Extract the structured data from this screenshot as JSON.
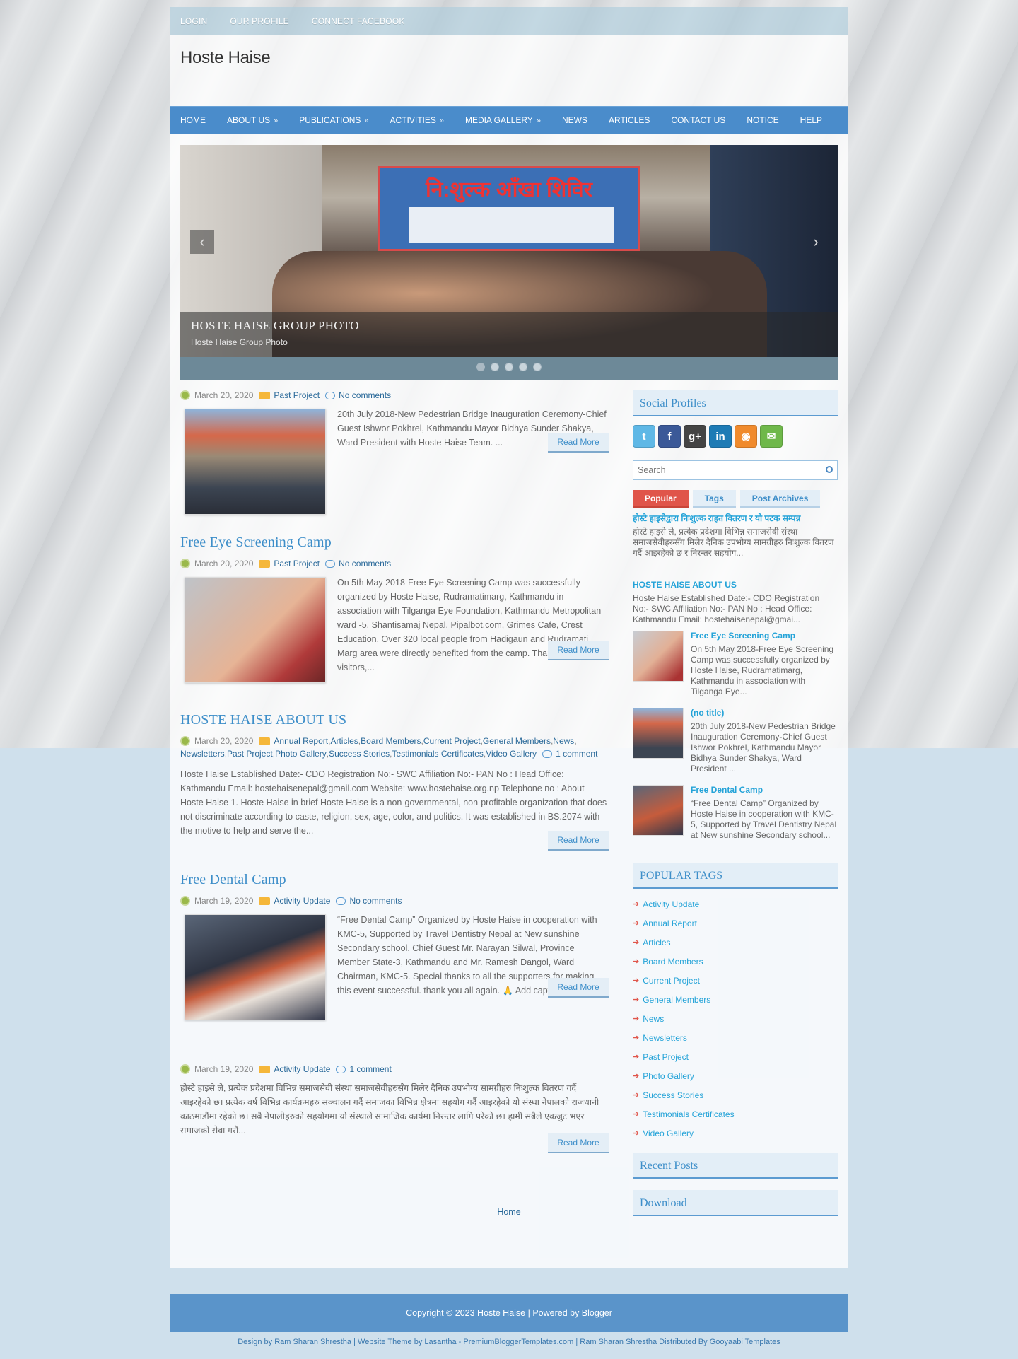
{
  "topbar": {
    "items": [
      "LOGIN",
      "OUR PROFILE",
      "CONNECT FACEBOOK"
    ]
  },
  "site": {
    "title": "Hoste Haise"
  },
  "nav": {
    "items": [
      {
        "label": "HOME",
        "sub": false
      },
      {
        "label": "ABOUT US",
        "sub": true
      },
      {
        "label": "PUBLICATIONS",
        "sub": true
      },
      {
        "label": "ACTIVITIES",
        "sub": true
      },
      {
        "label": "MEDIA GALLERY",
        "sub": true
      },
      {
        "label": "NEWS",
        "sub": false
      },
      {
        "label": "ARTICLES",
        "sub": false
      },
      {
        "label": "CONTACT US",
        "sub": false
      },
      {
        "label": "NOTICE",
        "sub": false
      },
      {
        "label": "HELP",
        "sub": false
      }
    ],
    "arrow": "»"
  },
  "slider": {
    "caption_title": "HOSTE HAISE GROUP PHOTO",
    "caption_sub": "Hoste Haise Group Photo",
    "banner_text": "नि:शुल्क आँखा शिविर",
    "prev": "‹",
    "next": "›",
    "dots": 5,
    "active_dot": 0
  },
  "posts": [
    {
      "title": "",
      "date": "March 20, 2020",
      "labels": [
        "Past Project"
      ],
      "comments": "No comments",
      "snippet": "20th July 2018-New Pedestrian Bridge Inauguration Ceremony-Chief Guest Ishwor Pokhrel, Kathmandu Mayor Bidhya Sunder Shakya, Ward President with Hoste Haise Team. ...",
      "read_more": "Read More"
    },
    {
      "title": "Free Eye Screening Camp",
      "date": "March 20, 2020",
      "labels": [
        "Past Project"
      ],
      "comments": "No comments",
      "snippet": "On 5th May 2018-Free Eye Screening Camp was successfully organized by Hoste Haise, Rudramatimarg, Kathmandu in association with Tilganga Eye Foundation, Kathmandu Metropolitan ward -5, Shantisamaj Nepal, Pipalbot.com, Grimes Cafe, Crest Education. Over 320 local people from Hadigaun and Rudramati Marg area were directly benefited from the camp. Thank you all the visitors,...",
      "read_more": "Read More"
    },
    {
      "title": "HOSTE HAISE ABOUT US",
      "date": "March 20, 2020",
      "labels": [
        "Annual Report",
        "Articles",
        "Board Members",
        "Current Project",
        "General Members",
        "News",
        "Newsletters",
        "Past Project",
        "Photo Gallery",
        "Success Stories",
        "Testimonials Certificates",
        "Video Gallery"
      ],
      "comments": "1 comment",
      "snippet": "Hoste Haise Established Date:- CDO Registration No:- SWC Affiliation No:- PAN No : Head Office: Kathmandu Email: hostehaisenepal@gmail.com Website: www.hostehaise.org.np Telephone no : About Hoste Haise 1. Hoste Haise in brief Hoste Haise is a non-governmental, non-profitable organization that does not discriminate according to caste, religion, sex, age, color, and politics. It was established in BS.2074 with the motive to help and serve the...",
      "read_more": "Read More"
    },
    {
      "title": "Free Dental Camp",
      "date": "March 19, 2020",
      "labels": [
        "Activity Update"
      ],
      "comments": "No comments",
      "snippet": "“Free Dental Camp” Organized by Hoste Haise in cooperation with KMC-5, Supported by Travel Dentistry Nepal at New sunshine Secondary school. Chief Guest Mr. Narayan Silwal, Province Member State-3, Kathmandu and Mr. Ramesh Dangol, Ward Chairman, KMC-5. Special thanks to all the supporters for making this event successful. thank you all again. 🙏 Add caption ...",
      "read_more": "Read More"
    },
    {
      "title": "",
      "date": "March 19, 2020",
      "labels": [
        "Activity Update"
      ],
      "comments": "1 comment",
      "snippet": "होस्टे हाइसे ले, प्रत्येक प्रदेशमा विभिन्न समाजसेवी संस्था समाजसेवीहरुसँग मिलेर दैनिक उपभोग्य सामग्रीहरु निःशुल्क वितरण गर्दै आइरहेको छ। प्रत्येक वर्ष विभिन्न कार्यक्रमहरु सञ्चालन गर्दै समाजका विभिन्न क्षेत्रमा सहयोग गर्दै आइरहेको यो संस्था नेपालको राजधानी काठमाडौंमा रहेको छ। सबै नेपालीहरुको सहयोगमा यो संस्थाले सामाजिक कार्यमा निरन्तर लागि परेको छ। हामी सबैले एकजुट भएर समाजको सेवा गरौं...",
      "read_more": "Read More"
    }
  ],
  "home_link": "Home",
  "sidebar": {
    "social_title": "Social Profiles",
    "social_icons": [
      {
        "name": "twitter",
        "glyph": "t",
        "color": "#5fb8e6"
      },
      {
        "name": "facebook",
        "glyph": "f",
        "color": "#3b5998"
      },
      {
        "name": "google-plus",
        "glyph": "g+",
        "color": "#444"
      },
      {
        "name": "linkedin",
        "glyph": "in",
        "color": "#1e7bb5"
      },
      {
        "name": "rss",
        "glyph": "◉",
        "color": "#f08a2c"
      },
      {
        "name": "email",
        "glyph": "✉",
        "color": "#6fb84a"
      }
    ],
    "search_placeholder": "Search",
    "tabs": [
      "Popular",
      "Tags",
      "Post Archives"
    ],
    "popular": [
      {
        "title": "होस्टे हाइसेद्वारा निःशुल्क राहत वितरण र यो पटक सम्पन्न",
        "text": "होस्टे हाइसे ले, प्रत्येक प्रदेशमा विभिन्न समाजसेवी संस्था समाजसेवीहरुसँग मिलेर दैनिक उपभोग्य सामग्रीहरु निःशुल्क वितरण गर्दै आइरहेको छ र निरन्तर सहयोग..."
      },
      {
        "title": "HOSTE HAISE ABOUT US",
        "text": "Hoste Haise Established Date:- CDO Registration No:- SWC Affiliation No:- PAN No : Head Office: Kathmandu Email: hostehaisenepal@gmai..."
      },
      {
        "title": "Free Eye Screening Camp",
        "text": "On 5th May 2018-Free Eye Screening Camp was successfully organized by Hoste Haise, Rudramatimarg, Kathmandu in association with Tilganga Eye..."
      },
      {
        "title": "(no title)",
        "text": "20th July 2018-New Pedestrian Bridge Inauguration Ceremony-Chief Guest Ishwor Pokhrel, Kathmandu Mayor Bidhya Sunder Shakya, Ward President ..."
      },
      {
        "title": "Free Dental Camp",
        "text": "“Free Dental Camp” Organized by Hoste Haise in cooperation with KMC-5, Supported by Travel Dentistry Nepal at New sunshine Secondary school..."
      }
    ],
    "tags_title": "POPULAR TAGS",
    "tags": [
      "Activity Update",
      "Annual Report",
      "Articles",
      "Board Members",
      "Current Project",
      "General Members",
      "News",
      "Newsletters",
      "Past Project",
      "Photo Gallery",
      "Success Stories",
      "Testimonials Certificates",
      "Video Gallery"
    ],
    "recent_title": "Recent Posts",
    "download_title": "Download"
  },
  "footer": {
    "copyright": "Copyright © 2023 Hoste Haise | Powered by Blogger",
    "credit": "Design by Ram Sharan Shrestha | Website Theme by Lasantha - PremiumBloggerTemplates.com | Ram Sharan Shrestha Distributed By Gooyaabi Templates"
  }
}
